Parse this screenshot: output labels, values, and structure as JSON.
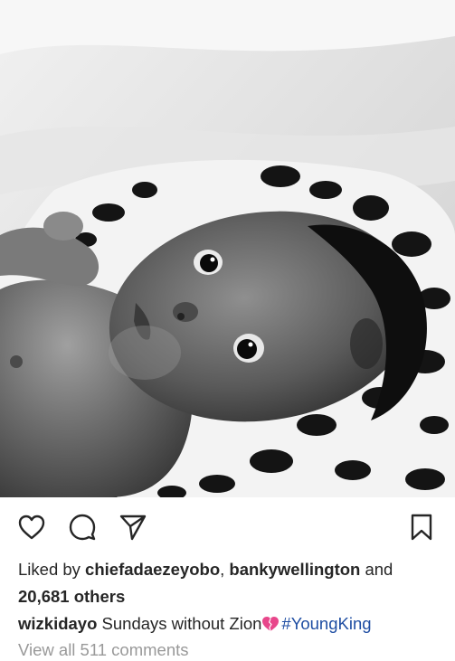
{
  "post": {
    "image_alt": "black and white photo of a baby lying on a patterned blanket",
    "likes": {
      "prefix": "Liked by ",
      "user1": "chiefadaezeyobo",
      "separator": ", ",
      "user2": "bankywellington",
      "and": " and",
      "count_text": "20,681 others"
    },
    "caption": {
      "username": "wizkidayo",
      "text": " Sundays without Zion",
      "emoji": "broken-heart-emoji",
      "hashtag": "#YoungKing"
    },
    "view_comments": "View all 511 comments"
  },
  "actions": {
    "like_icon": "heart-outline-icon",
    "comment_icon": "comment-bubble-icon",
    "share_icon": "paper-plane-icon",
    "save_icon": "bookmark-icon"
  },
  "colors": {
    "text": "#262626",
    "hashtag": "#1f4ea3",
    "muted": "#999999",
    "emoji_heart": "#e8478b"
  }
}
